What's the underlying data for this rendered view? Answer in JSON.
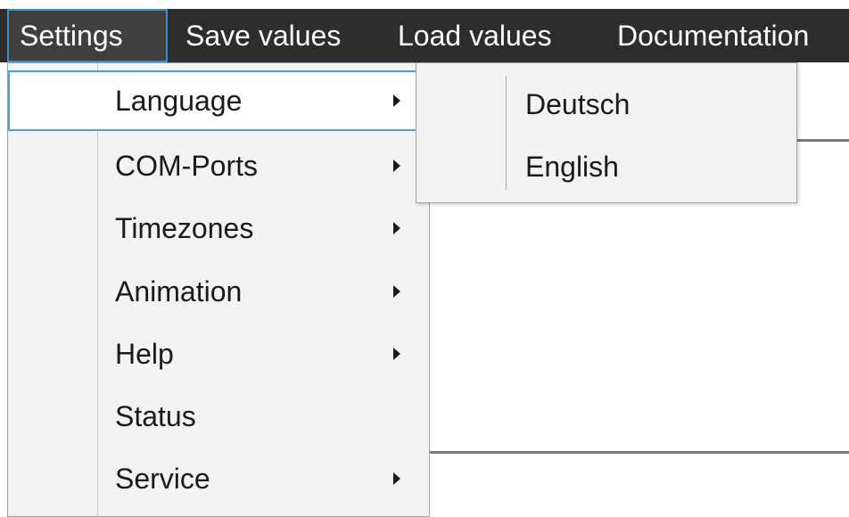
{
  "menubar": {
    "items": [
      {
        "label": "Settings"
      },
      {
        "label": "Save values"
      },
      {
        "label": "Load values"
      },
      {
        "label": "Documentation"
      }
    ],
    "active_item": "Settings",
    "colors": {
      "background": "#2d2d2d",
      "active_background": "#3f3f3f",
      "active_border": "#3a8fc7",
      "text": "#ffffff"
    }
  },
  "settings_menu": {
    "items": [
      {
        "label": "Language",
        "has_submenu": true,
        "highlighted": true
      },
      {
        "label": "COM-Ports",
        "has_submenu": true
      },
      {
        "label": "Timezones",
        "has_submenu": true
      },
      {
        "label": "Animation",
        "has_submenu": true
      },
      {
        "label": "Help",
        "has_submenu": true
      },
      {
        "label": "Status",
        "has_submenu": false
      },
      {
        "label": "Service",
        "has_submenu": true
      }
    ],
    "submenu_arrow_icon": "chevron-right-icon",
    "colors": {
      "background": "#f2f2f2",
      "highlight_border": "#4aa3df"
    }
  },
  "language_submenu": {
    "items": [
      {
        "label": "Deutsch"
      },
      {
        "label": "English"
      }
    ]
  }
}
